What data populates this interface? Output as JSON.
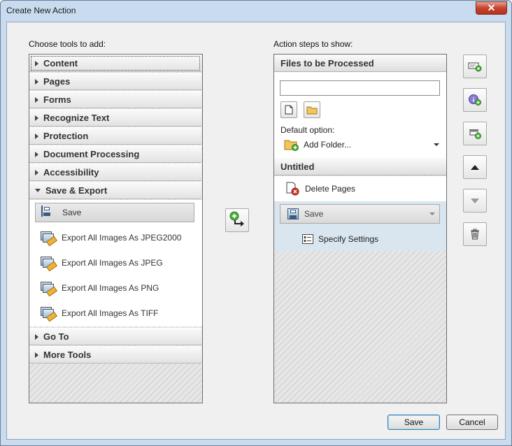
{
  "window": {
    "title": "Create New Action",
    "close_label": "✕"
  },
  "left": {
    "label": "Choose tools to add:",
    "categories_top": [
      {
        "label": "Content"
      },
      {
        "label": "Pages"
      },
      {
        "label": "Forms"
      },
      {
        "label": "Recognize Text"
      },
      {
        "label": "Protection"
      },
      {
        "label": "Document Processing"
      },
      {
        "label": "Accessibility"
      },
      {
        "label": "Save & Export"
      }
    ],
    "tools": [
      {
        "label": "Save"
      },
      {
        "label": "Export All Images As JPEG2000"
      },
      {
        "label": "Export All Images As JPEG"
      },
      {
        "label": "Export All Images As PNG"
      },
      {
        "label": "Export All Images As TIFF"
      }
    ],
    "categories_bottom": [
      {
        "label": "Go To"
      },
      {
        "label": "More Tools"
      }
    ]
  },
  "right": {
    "label": "Action steps to show:",
    "files_header": "Files to be Processed",
    "file_input_value": "",
    "default_option_label": "Default option:",
    "default_option_value": "Add Folder...",
    "untitled_header": "Untitled",
    "steps": [
      {
        "label": "Delete Pages"
      },
      {
        "label": "Save"
      }
    ],
    "sub_step": "Specify Settings"
  },
  "buttons": {
    "save": "Save",
    "cancel": "Cancel"
  }
}
